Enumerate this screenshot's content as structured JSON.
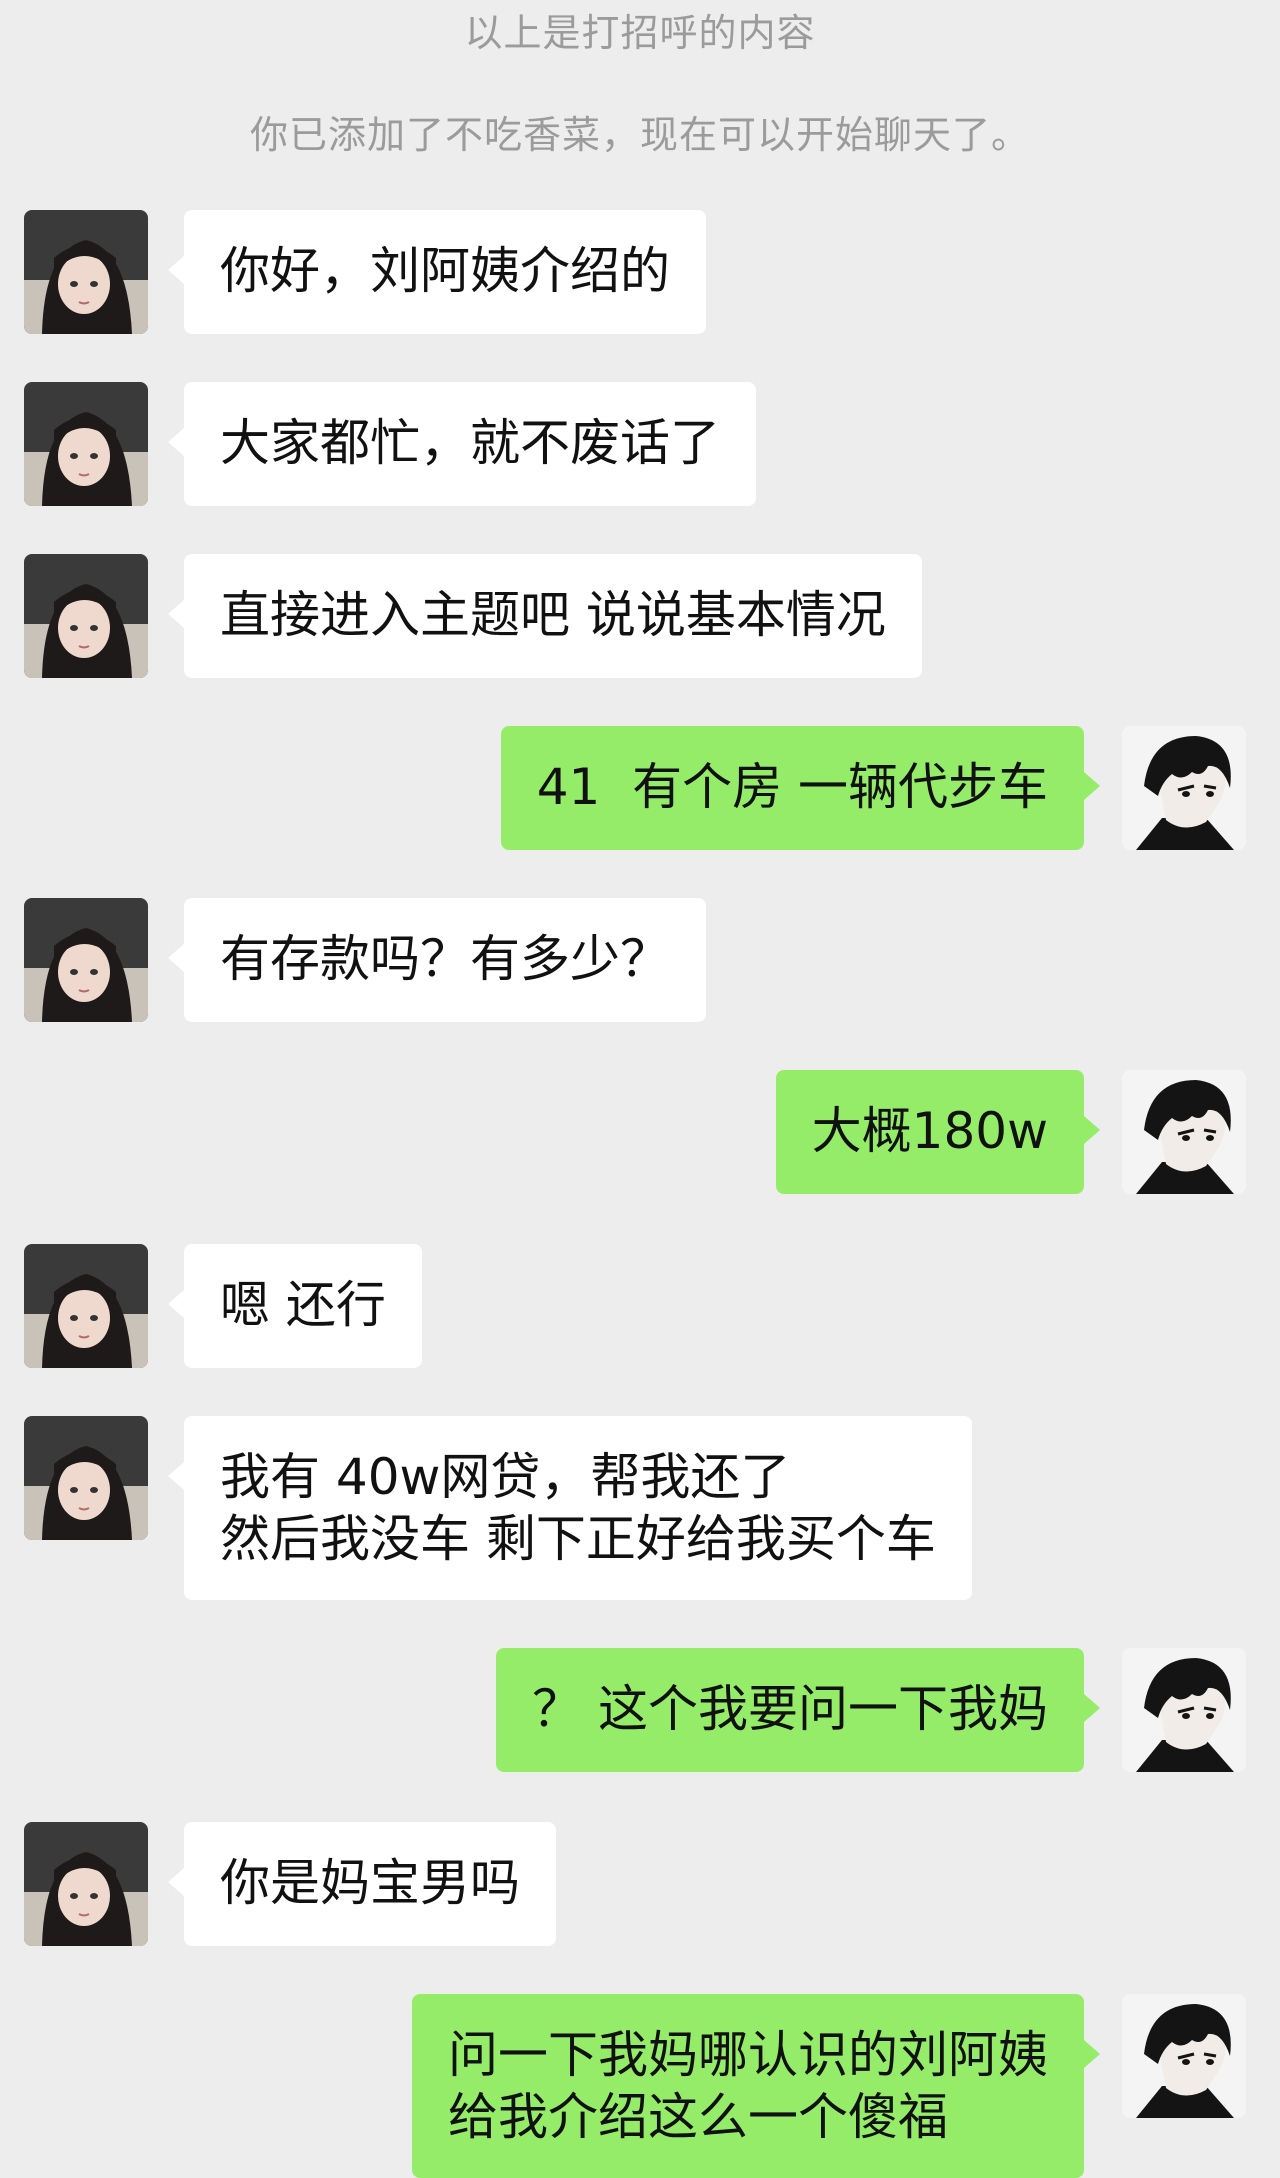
{
  "system": {
    "greeting_note": "以上是打招呼的内容",
    "added_note": "你已添加了不吃香菜，现在可以开始聊天了。"
  },
  "messages": [
    {
      "side": "left",
      "text": "你好，刘阿姨介绍的"
    },
    {
      "side": "left",
      "text": "大家都忙，就不废话了"
    },
    {
      "side": "left",
      "text": "直接进入主题吧 说说基本情况"
    },
    {
      "side": "right",
      "text": "41  有个房 一辆代步车"
    },
    {
      "side": "left",
      "text": "有存款吗？有多少？"
    },
    {
      "side": "right",
      "text": "大概180w"
    },
    {
      "side": "left",
      "text": "嗯 还行"
    },
    {
      "side": "left",
      "text": "我有 40w网贷，帮我还了\n然后我没车 剩下正好给我买个车"
    },
    {
      "side": "right",
      "text": "？ 这个我要问一下我妈"
    },
    {
      "side": "left",
      "text": "你是妈宝男吗"
    },
    {
      "side": "right",
      "text": "问一下我妈哪认识的刘阿姨\n给我介绍这么一个傻福"
    }
  ],
  "colors": {
    "background": "#ededed",
    "incoming_bubble": "#ffffff",
    "outgoing_bubble": "#95ec69",
    "system_text": "#9b9b9b"
  },
  "icons": {
    "incoming_avatar": "female-avatar-icon",
    "outgoing_avatar": "anime-male-avatar-icon"
  }
}
